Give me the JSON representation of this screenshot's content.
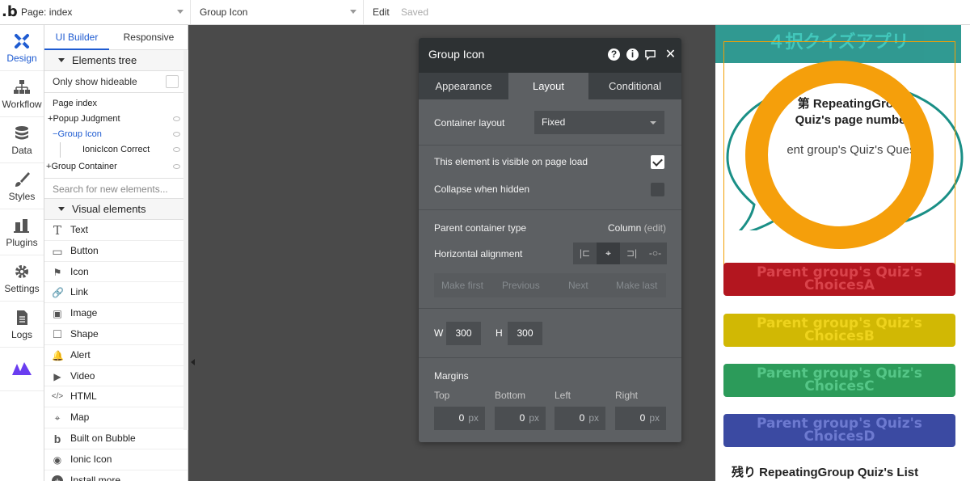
{
  "topbar": {
    "page_label": "Page: index",
    "element_label": "Group Icon",
    "edit_label": "Edit",
    "saved_label": "Saved"
  },
  "rail": [
    {
      "label": "Design",
      "icon": "design-icon"
    },
    {
      "label": "Workflow",
      "icon": "workflow-icon"
    },
    {
      "label": "Data",
      "icon": "database-icon"
    },
    {
      "label": "Styles",
      "icon": "brush-icon"
    },
    {
      "label": "Plugins",
      "icon": "plug-icon"
    },
    {
      "label": "Settings",
      "icon": "gear-icon"
    },
    {
      "label": "Logs",
      "icon": "document-icon"
    },
    {
      "label": "",
      "icon": "brand-logo-icon"
    }
  ],
  "panel": {
    "tab_ui": "UI Builder",
    "tab_responsive": "Responsive",
    "elements_tree_title": "Elements tree",
    "only_hideable": "Only show hideable",
    "tree": [
      {
        "label": "Page index",
        "indent": 0,
        "prefix": ""
      },
      {
        "label": "Popup Judgment",
        "indent": 0,
        "prefix": "+"
      },
      {
        "label": "Group Icon",
        "indent": 1,
        "prefix": "−"
      },
      {
        "label": "IonicIcon Correct",
        "indent": 2,
        "prefix": ""
      },
      {
        "label": "Group Container",
        "indent": 0,
        "prefix": "+"
      }
    ],
    "search_placeholder": "Search for new elements...",
    "visual_elements_title": "Visual elements",
    "visual_elements": [
      {
        "label": "Text",
        "icon": "T"
      },
      {
        "label": "Button",
        "icon": "▭"
      },
      {
        "label": "Icon",
        "icon": "⚑"
      },
      {
        "label": "Link",
        "icon": "🔗"
      },
      {
        "label": "Image",
        "icon": "▣"
      },
      {
        "label": "Shape",
        "icon": "□"
      },
      {
        "label": "Alert",
        "icon": "🔔"
      },
      {
        "label": "Video",
        "icon": "▶"
      },
      {
        "label": "HTML",
        "icon": "</>"
      },
      {
        "label": "Map",
        "icon": "⌖"
      },
      {
        "label": "Built on Bubble",
        "icon": "b"
      },
      {
        "label": "Ionic Icon",
        "icon": "◉"
      },
      {
        "label": "Install more...",
        "icon": "+"
      }
    ]
  },
  "canvas": {
    "app_header": "４択クイズアプリ",
    "q_number": "第 RepeatingGroup\nQuiz's page number",
    "q_question": "ent group's Quiz's Quest",
    "choices": [
      "Parent group's Quiz's\nChoicesA",
      "Parent group's Quiz's\nChoicesB",
      "Parent group's Quiz's\nChoicesC",
      "Parent group's Quiz's\nChoicesD"
    ],
    "remaining": "残り RepeatingGroup Quiz's List"
  },
  "editor": {
    "title": "Group Icon",
    "tabs": [
      "Appearance",
      "Layout",
      "Conditional"
    ],
    "container_layout_label": "Container layout",
    "container_layout_value": "Fixed",
    "visible_on_load_label": "This element is visible on page load",
    "visible_on_load": true,
    "collapse_label": "Collapse when hidden",
    "collapse_when_hidden": false,
    "parent_type_label": "Parent container type",
    "parent_type_value": "Column",
    "parent_type_edit": "(edit)",
    "h_align_label": "Horizontal alignment",
    "move": [
      "Make first",
      "Previous",
      "Next",
      "Make last"
    ],
    "w_label": "W",
    "w_value": "300",
    "h_label": "H",
    "h_value": "300",
    "margins_label": "Margins",
    "margin_labels": [
      "Top",
      "Bottom",
      "Left",
      "Right"
    ],
    "margin_values": [
      "0",
      "0",
      "0",
      "0"
    ],
    "unit": "px"
  },
  "colors": {
    "accent": "#1e5bd1",
    "ring": "#f59f0b",
    "editor_bg": "#5d6063",
    "editor_head": "#2d3133"
  }
}
